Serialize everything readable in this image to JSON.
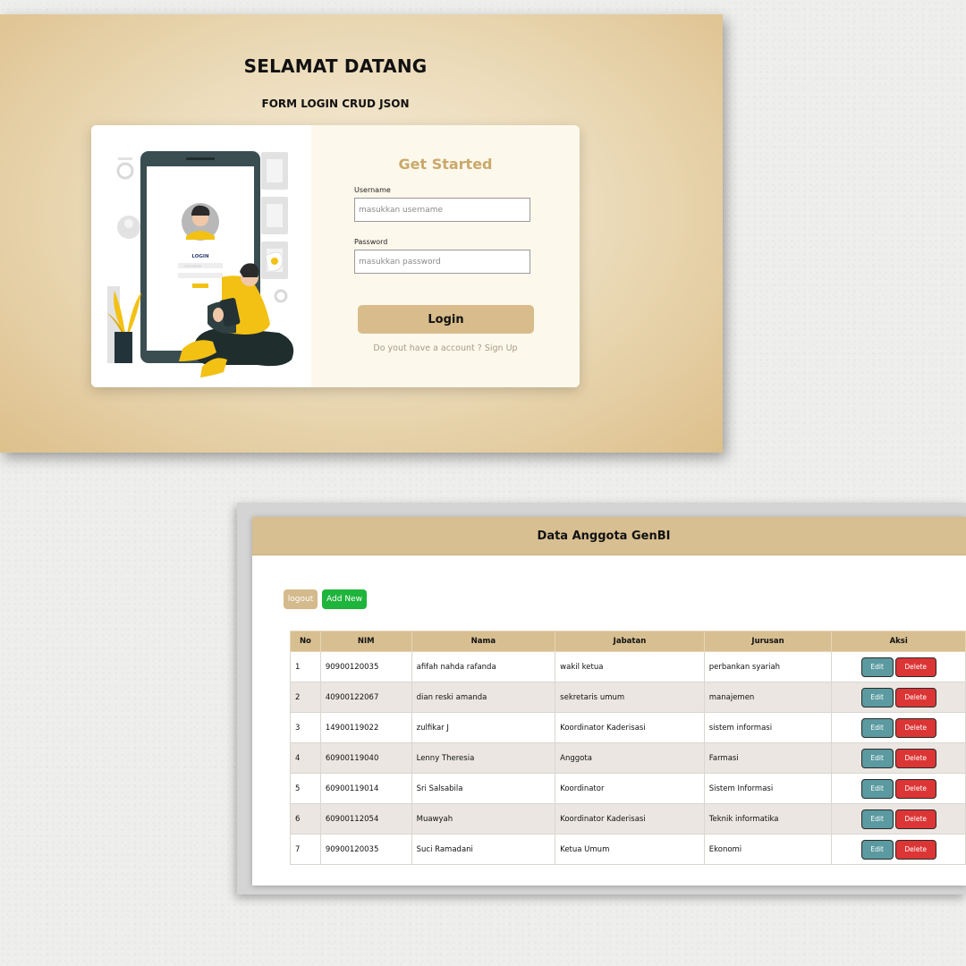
{
  "login": {
    "title": "SELAMAT DATANG",
    "subtitle": "FORM LOGIN CRUD JSON",
    "form_heading": "Get Started",
    "username_label": "Username",
    "username_placeholder": "masukkan username",
    "password_label": "Password",
    "password_placeholder": "masukkan password",
    "login_button": "Login",
    "signup_prompt": "Do yout have a account ?",
    "signup_link": "Sign Up",
    "illustration": {
      "phone_label": "LOGIN",
      "phone_username": "Username"
    }
  },
  "members": {
    "title": "Data Anggota GenBI",
    "logout_label": "logout",
    "add_new_label": "Add New",
    "columns": [
      "No",
      "NIM",
      "Nama",
      "Jabatan",
      "Jurusan",
      "Aksi"
    ],
    "edit_label": "Edit",
    "delete_label": "Delete",
    "rows": [
      {
        "no": "1",
        "nim": "90900120035",
        "nama": "afifah nahda rafanda",
        "jabatan": "wakil ketua",
        "jurusan": "perbankan syariah"
      },
      {
        "no": "2",
        "nim": "40900122067",
        "nama": "dian reski amanda",
        "jabatan": "sekretaris umum",
        "jurusan": "manajemen"
      },
      {
        "no": "3",
        "nim": "14900119022",
        "nama": "zulfikar J",
        "jabatan": "Koordinator Kaderisasi",
        "jurusan": "sistem informasi"
      },
      {
        "no": "4",
        "nim": "60900119040",
        "nama": "Lenny Theresia",
        "jabatan": "Anggota",
        "jurusan": "Farmasi"
      },
      {
        "no": "5",
        "nim": "60900119014",
        "nama": "Sri Salsabila",
        "jabatan": "Koordinator",
        "jurusan": "Sistem Informasi"
      },
      {
        "no": "6",
        "nim": "60900112054",
        "nama": "Muawyah",
        "jabatan": "Koordinator Kaderisasi",
        "jurusan": "Teknik informatika"
      },
      {
        "no": "7",
        "nim": "90900120035",
        "nama": "Suci Ramadani",
        "jabatan": "Ketua Umum",
        "jurusan": "Ekonomi"
      }
    ]
  },
  "colors": {
    "accent_tan": "#d8bf91",
    "heading_gold": "#c9a86a",
    "add_green": "#1fb43c",
    "edit_teal": "#5a9aa0",
    "delete_red": "#dc3535"
  }
}
